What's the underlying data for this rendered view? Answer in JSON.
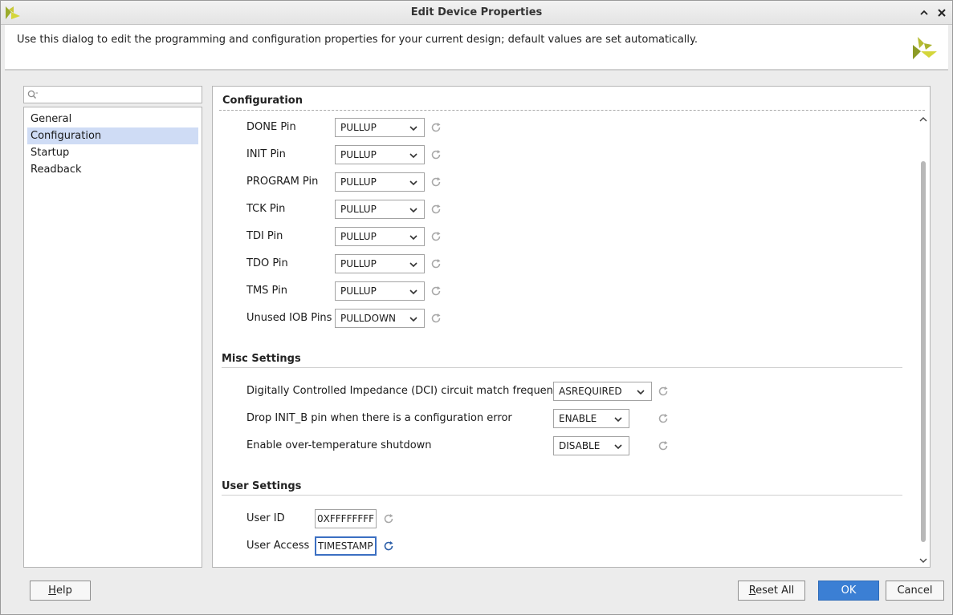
{
  "window": {
    "title": "Edit Device Properties"
  },
  "header": {
    "description": "Use this dialog to edit the programming and configuration properties for your current design; default values are set automatically."
  },
  "nav": {
    "search_placeholder": "",
    "items": [
      {
        "label": "General",
        "selected": false
      },
      {
        "label": "Configuration",
        "selected": true
      },
      {
        "label": "Startup",
        "selected": false
      },
      {
        "label": "Readback",
        "selected": false
      }
    ]
  },
  "content": {
    "section_title": "Configuration",
    "pins": [
      {
        "label": "DONE Pin",
        "value": "PULLUP"
      },
      {
        "label": "INIT Pin",
        "value": "PULLUP"
      },
      {
        "label": "PROGRAM Pin",
        "value": "PULLUP"
      },
      {
        "label": "TCK Pin",
        "value": "PULLUP"
      },
      {
        "label": "TDI Pin",
        "value": "PULLUP"
      },
      {
        "label": "TDO Pin",
        "value": "PULLUP"
      },
      {
        "label": "TMS Pin",
        "value": "PULLUP"
      },
      {
        "label": "Unused IOB Pins",
        "value": "PULLDOWN"
      }
    ],
    "misc": {
      "title": "Misc Settings",
      "rows": [
        {
          "label": "Digitally Controlled Impedance (DCI) circuit match frequency",
          "value": "ASREQUIRED"
        },
        {
          "label": "Drop INIT_B pin when there is a configuration error",
          "value": "ENABLE"
        },
        {
          "label": "Enable over-temperature shutdown",
          "value": "DISABLE"
        }
      ]
    },
    "user": {
      "title": "User Settings",
      "user_id_label": "User ID",
      "user_id_value": "0XFFFFFFFF",
      "user_access_label": "User Access",
      "user_access_value": "TIMESTAMP"
    }
  },
  "buttons": {
    "help_mnemonic": "H",
    "help_rest": "elp",
    "reset_mnemonic": "R",
    "reset_rest": "eset All",
    "ok": "OK",
    "cancel": "Cancel"
  },
  "colors": {
    "accent": "#3b7fd4",
    "selection": "#cfdcf5",
    "logo_green": "#9aab2a",
    "logo_yellow": "#d4d63a"
  }
}
